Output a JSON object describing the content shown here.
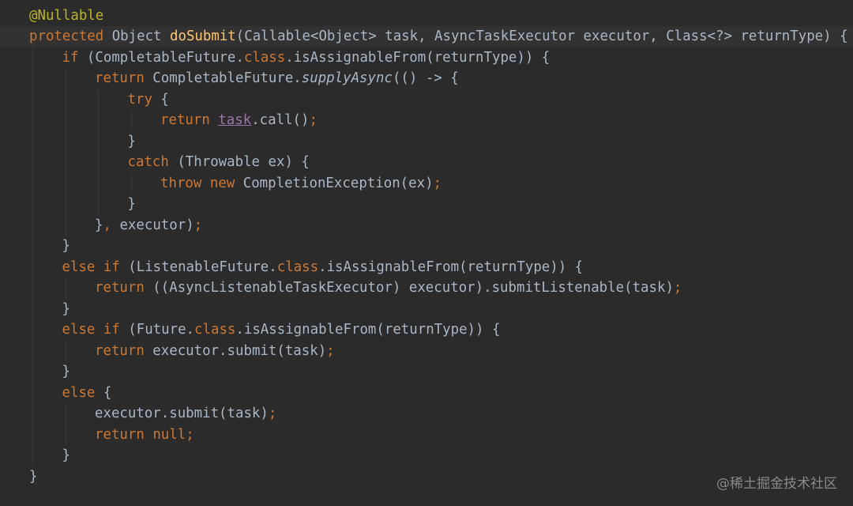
{
  "editor": {
    "theme_colors": {
      "background": "#2b2b2b",
      "current_line": "#323232",
      "default_text": "#a9b7c6",
      "keyword": "#cc7832",
      "annotation": "#bbb529",
      "method_declaration": "#ffc66d",
      "field": "#9876aa"
    },
    "lines": [
      {
        "indent": 0,
        "tokens": [
          {
            "t": "@Nullable",
            "k": "ann"
          }
        ]
      },
      {
        "indent": 0,
        "current": true,
        "tokens": [
          {
            "t": "protected",
            "k": "kw"
          },
          {
            "t": " Object ",
            "k": "default"
          },
          {
            "t": "doSubmit",
            "k": "fn"
          },
          {
            "t": "(Callable<Object> task, AsyncTaskExecutor executor, Class<?> returnType) {",
            "k": "default"
          }
        ]
      },
      {
        "indent": 1,
        "tokens": [
          {
            "t": "if",
            "k": "kw"
          },
          {
            "t": " (CompletableFuture.",
            "k": "default"
          },
          {
            "t": "class",
            "k": "kw"
          },
          {
            "t": ".isAssignableFrom(returnType)) {",
            "k": "default"
          }
        ]
      },
      {
        "indent": 2,
        "tokens": [
          {
            "t": "return",
            "k": "kw"
          },
          {
            "t": " CompletableFuture.",
            "k": "default"
          },
          {
            "t": "supplyAsync",
            "k": "it"
          },
          {
            "t": "(() -> {",
            "k": "default"
          }
        ]
      },
      {
        "indent": 3,
        "tokens": [
          {
            "t": "try",
            "k": "kw"
          },
          {
            "t": " {",
            "k": "default"
          }
        ]
      },
      {
        "indent": 4,
        "tokens": [
          {
            "t": "return",
            "k": "kw"
          },
          {
            "t": " ",
            "k": "default"
          },
          {
            "t": "task",
            "k": "field"
          },
          {
            "t": ".call()",
            "k": "default"
          },
          {
            "t": ";",
            "k": "kw"
          }
        ]
      },
      {
        "indent": 3,
        "tokens": [
          {
            "t": "}",
            "k": "default"
          }
        ]
      },
      {
        "indent": 3,
        "tokens": [
          {
            "t": "catch",
            "k": "kw"
          },
          {
            "t": " (Throwable ex) {",
            "k": "default"
          }
        ]
      },
      {
        "indent": 4,
        "tokens": [
          {
            "t": "throw",
            "k": "kw"
          },
          {
            "t": " ",
            "k": "default"
          },
          {
            "t": "new",
            "k": "kw"
          },
          {
            "t": " CompletionException(ex)",
            "k": "default"
          },
          {
            "t": ";",
            "k": "kw"
          }
        ]
      },
      {
        "indent": 3,
        "tokens": [
          {
            "t": "}",
            "k": "default"
          }
        ]
      },
      {
        "indent": 2,
        "tokens": [
          {
            "t": "}",
            "k": "default"
          },
          {
            "t": ",",
            "k": "kw"
          },
          {
            "t": " executor)",
            "k": "default"
          },
          {
            "t": ";",
            "k": "kw"
          }
        ]
      },
      {
        "indent": 1,
        "tokens": [
          {
            "t": "}",
            "k": "default"
          }
        ]
      },
      {
        "indent": 1,
        "tokens": [
          {
            "t": "else if",
            "k": "kw"
          },
          {
            "t": " (ListenableFuture.",
            "k": "default"
          },
          {
            "t": "class",
            "k": "kw"
          },
          {
            "t": ".isAssignableFrom(returnType)) {",
            "k": "default"
          }
        ]
      },
      {
        "indent": 2,
        "tokens": [
          {
            "t": "return",
            "k": "kw"
          },
          {
            "t": " ((AsyncListenableTaskExecutor) executor).submitListenable(task)",
            "k": "default"
          },
          {
            "t": ";",
            "k": "kw"
          }
        ]
      },
      {
        "indent": 1,
        "tokens": [
          {
            "t": "}",
            "k": "default"
          }
        ]
      },
      {
        "indent": 1,
        "tokens": [
          {
            "t": "else if",
            "k": "kw"
          },
          {
            "t": " (Future.",
            "k": "default"
          },
          {
            "t": "class",
            "k": "kw"
          },
          {
            "t": ".isAssignableFrom(returnType)) {",
            "k": "default"
          }
        ]
      },
      {
        "indent": 2,
        "tokens": [
          {
            "t": "return",
            "k": "kw"
          },
          {
            "t": " executor.submit(task)",
            "k": "default"
          },
          {
            "t": ";",
            "k": "kw"
          }
        ]
      },
      {
        "indent": 1,
        "tokens": [
          {
            "t": "}",
            "k": "default"
          }
        ]
      },
      {
        "indent": 1,
        "tokens": [
          {
            "t": "else",
            "k": "kw"
          },
          {
            "t": " {",
            "k": "default"
          }
        ]
      },
      {
        "indent": 2,
        "tokens": [
          {
            "t": "executor.submit(task)",
            "k": "default"
          },
          {
            "t": ";",
            "k": "kw"
          }
        ]
      },
      {
        "indent": 2,
        "tokens": [
          {
            "t": "return",
            "k": "kw"
          },
          {
            "t": " ",
            "k": "default"
          },
          {
            "t": "null",
            "k": "kw"
          },
          {
            "t": ";",
            "k": "kw"
          }
        ]
      },
      {
        "indent": 1,
        "tokens": [
          {
            "t": "}",
            "k": "default"
          }
        ]
      },
      {
        "indent": 0,
        "tokens": [
          {
            "t": "}",
            "k": "default"
          }
        ]
      }
    ]
  },
  "watermark": {
    "text": "@稀土掘金技术社区"
  }
}
